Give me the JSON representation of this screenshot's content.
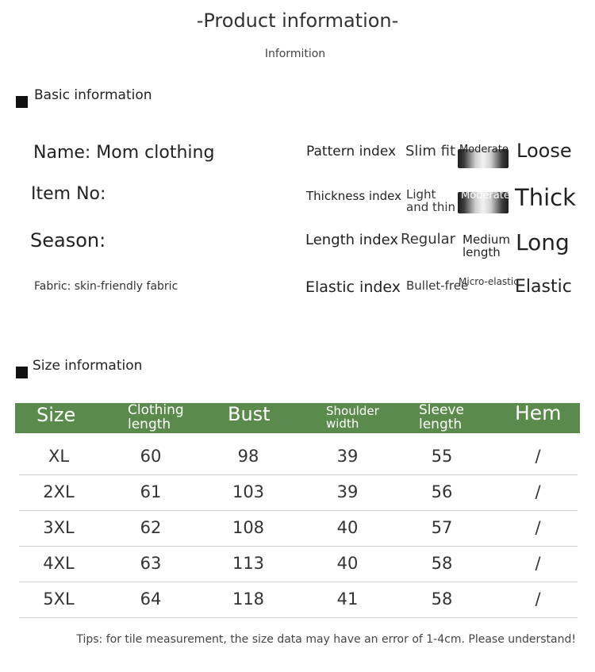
{
  "header": {
    "title": "-Product information-",
    "subtitle": "Informition"
  },
  "basic": {
    "heading": "Basic information",
    "name": "Name: Mom clothing",
    "item_no": "Item No:",
    "season": "Season:",
    "fabric": "Fabric: skin-friendly fabric"
  },
  "indices": {
    "pattern": {
      "label": "Pattern index",
      "opt1": "Slim fit",
      "mid": "Moderate",
      "opt3": "Loose",
      "selected": "Moderate"
    },
    "thickness": {
      "label": "Thickness index",
      "opt1_line1": "Light",
      "opt1_line2": "and thin",
      "mid": "Moderate",
      "opt3": "Thick",
      "selected": "Moderate"
    },
    "length": {
      "label": "Length index",
      "opt1": "Regular",
      "mid_line1": "Medium",
      "mid_line2": "length",
      "opt3": "Long"
    },
    "elastic": {
      "label": "Elastic index",
      "opt1": "Bullet-free",
      "mid": "Micro-elastic",
      "opt3": "Elastic"
    }
  },
  "size_section": {
    "heading": "Size information",
    "header_color": "#5b8b4c",
    "columns": {
      "size": "Size",
      "clothing_length_1": "Clothing",
      "clothing_length_2": "length",
      "bust": "Bust",
      "shoulder_1": "Shoulder",
      "shoulder_2": "width",
      "sleeve_1": "Sleeve",
      "sleeve_2": "length",
      "hem": "Hem"
    },
    "rows": [
      [
        "XL",
        "60",
        "98",
        "39",
        "55",
        "/"
      ],
      [
        "2XL",
        "61",
        "103",
        "39",
        "56",
        "/"
      ],
      [
        "3XL",
        "62",
        "108",
        "40",
        "57",
        "/"
      ],
      [
        "4XL",
        "63",
        "113",
        "40",
        "58",
        "/"
      ],
      [
        "5XL",
        "64",
        "118",
        "41",
        "58",
        "/"
      ]
    ]
  },
  "tips": "Tips: for tile measurement, the size data may have an error of 1-4cm. Please understand!"
}
